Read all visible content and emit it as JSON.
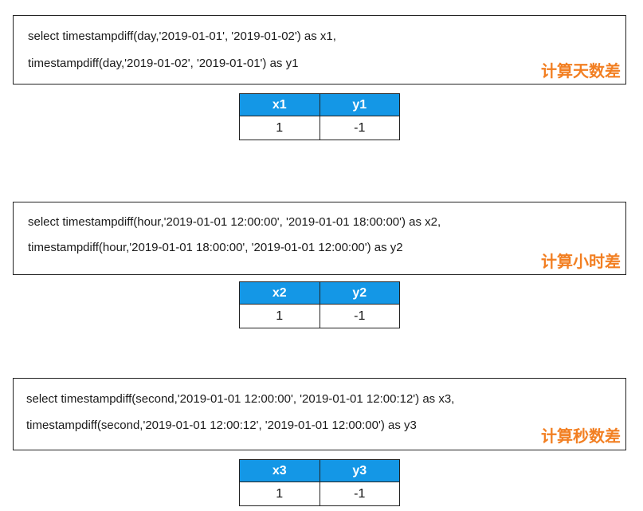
{
  "examples": [
    {
      "line1": "select timestampdiff(day,'2019-01-01', '2019-01-02') as x1,",
      "line2": "timestampdiff(day,'2019-01-02', '2019-01-01') as y1",
      "tag": "计算天数差",
      "columns": [
        "x1",
        "y1"
      ],
      "values": [
        "1",
        "-1"
      ]
    },
    {
      "line1": "select timestampdiff(hour,'2019-01-01 12:00:00', '2019-01-01 18:00:00') as x2,",
      "line2": "timestampdiff(hour,'2019-01-01 18:00:00', '2019-01-01 12:00:00') as y2",
      "tag": "计算小时差",
      "columns": [
        "x2",
        "y2"
      ],
      "values": [
        "1",
        "-1"
      ]
    },
    {
      "line1": "select timestampdiff(second,'2019-01-01 12:00:00', '2019-01-01 12:00:12') as x3,",
      "line2": "timestampdiff(second,'2019-01-01 12:00:12', '2019-01-01 12:00:00') as y3",
      "tag": "计算秒数差",
      "columns": [
        "x3",
        "y3"
      ],
      "values": [
        "1",
        "-1"
      ]
    }
  ],
  "colors": {
    "header_bg": "#1497e6",
    "tag": "#f27f22"
  }
}
